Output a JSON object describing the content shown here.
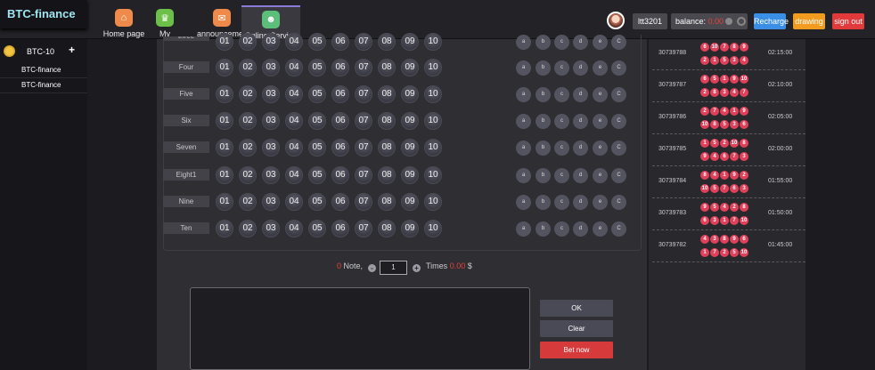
{
  "brand": "BTC-finance",
  "nav": [
    {
      "label": "Home page",
      "icon": "home-icon",
      "color": "#f08a4b",
      "glyph": "⌂"
    },
    {
      "label": "My",
      "icon": "crown-icon",
      "color": "#6cc04a",
      "glyph": "♛"
    },
    {
      "label": "announcement",
      "icon": "mail-icon",
      "color": "#f08a4b",
      "glyph": "✉"
    },
    {
      "label": "Online Service",
      "icon": "support-icon",
      "color": "#5bbf7a",
      "glyph": "☻"
    }
  ],
  "user": {
    "name": "ltt3201",
    "balance_label": "balance:",
    "balance": "0.00"
  },
  "topbuttons": {
    "recharge": "Recharge",
    "drawing": "drawing",
    "signout": "sign out"
  },
  "colors": {
    "recharge": "#3a8ee6",
    "drawing": "#f29b1f",
    "signout": "#e23a3a",
    "bet": "#d63a3a",
    "ok": "#4a4956",
    "clear": "#4a4956"
  },
  "sidebar": {
    "lottery": "BTC-10",
    "items": [
      "BTC-finance",
      "BTC-finance"
    ]
  },
  "grid": {
    "rows": [
      "three",
      "Four",
      "Five",
      "Six",
      "Seven",
      "Eight1",
      "Nine",
      "Ten"
    ],
    "numbers": [
      "01",
      "02",
      "03",
      "04",
      "05",
      "06",
      "07",
      "08",
      "09",
      "10"
    ],
    "quick": [
      "a",
      "b",
      "c",
      "d",
      "e",
      "C"
    ]
  },
  "notebar": {
    "notes": "0",
    "notes_label": "Note,",
    "qty": "1",
    "times_label": "Times",
    "amount": "0.00",
    "currency": "$"
  },
  "actions": {
    "ok": "OK",
    "clear": "Clear",
    "bet": "Bet now"
  },
  "history": [
    {
      "issue": "30739788",
      "time": "02:15:00",
      "row1": [
        "6",
        "10",
        "7",
        "8",
        "9"
      ],
      "row2": [
        "2",
        "1",
        "5",
        "3",
        "4"
      ]
    },
    {
      "issue": "30739787",
      "time": "02:10:00",
      "row1": [
        "6",
        "5",
        "1",
        "9",
        "10"
      ],
      "row2": [
        "2",
        "8",
        "3",
        "4",
        "7"
      ]
    },
    {
      "issue": "30739786",
      "time": "02:05:00",
      "row1": [
        "2",
        "7",
        "4",
        "1",
        "9"
      ],
      "row2": [
        "10",
        "8",
        "5",
        "3",
        "6"
      ]
    },
    {
      "issue": "30739785",
      "time": "02:00:00",
      "row1": [
        "1",
        "5",
        "2",
        "10",
        "8"
      ],
      "row2": [
        "9",
        "4",
        "6",
        "7",
        "3"
      ]
    },
    {
      "issue": "30739784",
      "time": "01:55:00",
      "row1": [
        "8",
        "4",
        "1",
        "9",
        "2"
      ],
      "row2": [
        "10",
        "5",
        "7",
        "6",
        "3"
      ]
    },
    {
      "issue": "30739783",
      "time": "01:50:00",
      "row1": [
        "9",
        "5",
        "4",
        "2",
        "8"
      ],
      "row2": [
        "6",
        "3",
        "1",
        "7",
        "10"
      ]
    },
    {
      "issue": "30739782",
      "time": "01:45:00",
      "row1": [
        "4",
        "3",
        "8",
        "9",
        "6"
      ],
      "row2": [
        "1",
        "7",
        "2",
        "5",
        "10"
      ]
    }
  ]
}
